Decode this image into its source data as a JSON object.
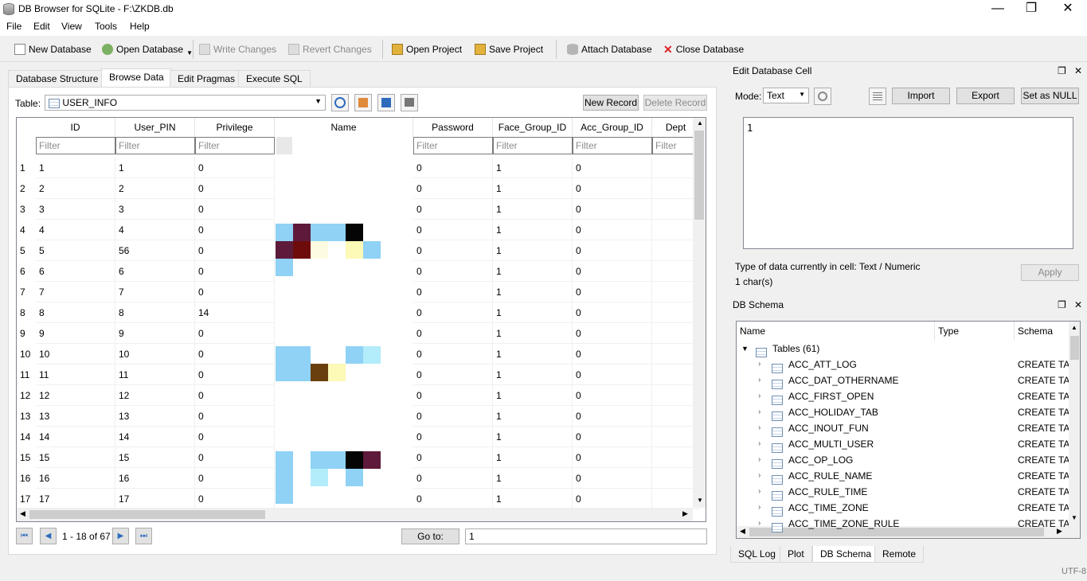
{
  "window": {
    "title": "DB Browser for SQLite - F:\\ZKDB.db",
    "minimize": "—",
    "restore": "❐",
    "close": "✕"
  },
  "menu": [
    "File",
    "Edit",
    "View",
    "Tools",
    "Help"
  ],
  "toolbar": {
    "new_db": "New Database",
    "open_db": "Open Database",
    "write": "Write Changes",
    "revert": "Revert Changes",
    "open_project": "Open Project",
    "save_project": "Save Project",
    "attach": "Attach Database",
    "close_db": "Close Database"
  },
  "tabs": [
    "Database Structure",
    "Browse Data",
    "Edit Pragmas",
    "Execute SQL"
  ],
  "browse": {
    "table_label": "Table:",
    "table_value": "USER_INFO",
    "new_record": "New Record",
    "delete_record": "Delete Record",
    "filter_placeholder": "Filter",
    "columns": [
      "ID",
      "User_PIN",
      "Privilege",
      "Name",
      "Password",
      "Face_Group_ID",
      "Acc_Group_ID",
      "Dept"
    ],
    "rows": [
      [
        "1",
        "1",
        "1",
        "0",
        "0",
        "1",
        "0"
      ],
      [
        "2",
        "2",
        "2",
        "0",
        "0",
        "1",
        "0"
      ],
      [
        "3",
        "3",
        "3",
        "0",
        "0",
        "1",
        "0"
      ],
      [
        "4",
        "4",
        "4",
        "0",
        "0",
        "1",
        "0"
      ],
      [
        "5",
        "5",
        "56",
        "0",
        "0",
        "1",
        "0"
      ],
      [
        "6",
        "6",
        "6",
        "0",
        "0",
        "1",
        "0"
      ],
      [
        "7",
        "7",
        "7",
        "0",
        "0",
        "1",
        "0"
      ],
      [
        "8",
        "8",
        "8",
        "14",
        "0",
        "1",
        "0"
      ],
      [
        "9",
        "9",
        "9",
        "0",
        "0",
        "1",
        "0"
      ],
      [
        "10",
        "10",
        "10",
        "0",
        "0",
        "1",
        "0"
      ],
      [
        "11",
        "11",
        "11",
        "0",
        "0",
        "1",
        "0"
      ],
      [
        "12",
        "12",
        "12",
        "0",
        "0",
        "1",
        "0"
      ],
      [
        "13",
        "13",
        "13",
        "0",
        "0",
        "1",
        "0"
      ],
      [
        "14",
        "14",
        "14",
        "0",
        "0",
        "1",
        "0"
      ],
      [
        "15",
        "15",
        "15",
        "0",
        "0",
        "1",
        "0"
      ],
      [
        "16",
        "16",
        "16",
        "0",
        "0",
        "1",
        "0"
      ],
      [
        "17",
        "17",
        "17",
        "0",
        "0",
        "1",
        "0"
      ]
    ],
    "record_info": "1 - 18 of 67",
    "goto_label": "Go to:",
    "goto_value": "1"
  },
  "edit_cell": {
    "title": "Edit Database Cell",
    "mode_label": "Mode:",
    "mode_value": "Text",
    "import": "Import",
    "export": "Export",
    "set_null": "Set as NULL",
    "content": "1",
    "type_info": "Type of data currently in cell: Text / Numeric",
    "chars": "1 char(s)",
    "apply": "Apply"
  },
  "schema": {
    "title": "DB Schema",
    "headers": [
      "Name",
      "Type",
      "Schema"
    ],
    "tables_label": "Tables (61)",
    "items": [
      "ACC_ATT_LOG",
      "ACC_DAT_OTHERNAME",
      "ACC_FIRST_OPEN",
      "ACC_HOLIDAY_TAB",
      "ACC_INOUT_FUN",
      "ACC_MULTI_USER",
      "ACC_OP_LOG",
      "ACC_RULE_NAME",
      "ACC_RULE_TIME",
      "ACC_TIME_ZONE",
      "ACC_TIME_ZONE_RULE"
    ],
    "schema_value": "CREATE TAE"
  },
  "bottom_tabs": [
    "SQL Log",
    "Plot",
    "DB Schema",
    "Remote"
  ],
  "status": "UTF-8"
}
